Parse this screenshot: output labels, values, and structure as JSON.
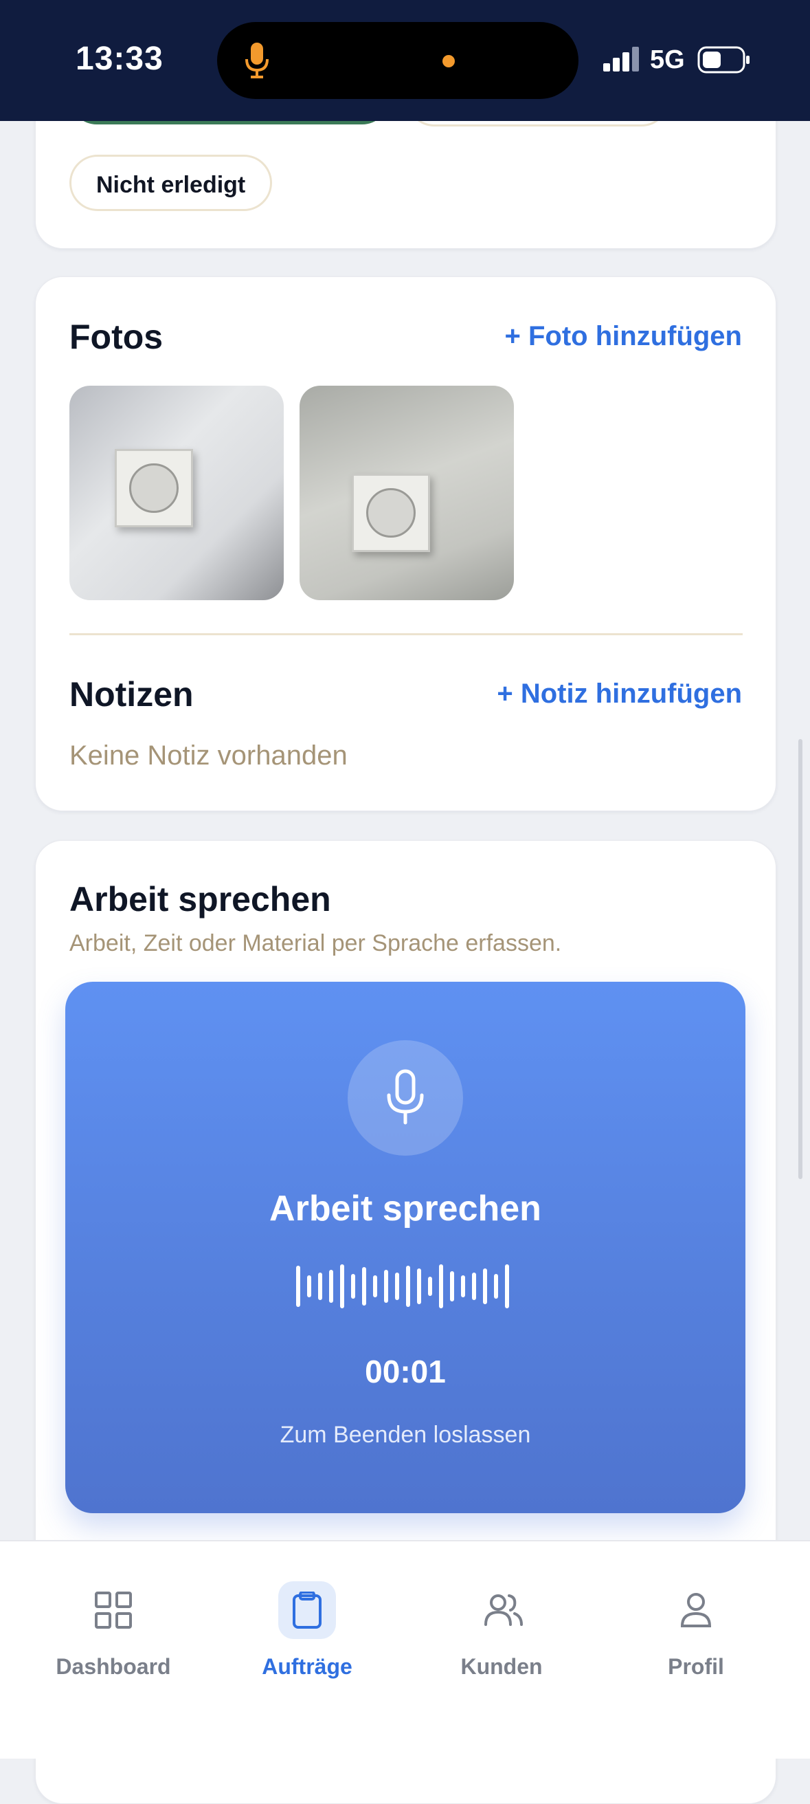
{
  "status_bar": {
    "time": "13:33",
    "network": "5G"
  },
  "status_card": {
    "not_done_label": "Nicht erledigt"
  },
  "photos": {
    "title": "Fotos",
    "add_label": "+ Foto hinzufügen"
  },
  "notes": {
    "title": "Notizen",
    "add_label": "+ Notiz hinzufügen",
    "empty_text": "Keine Notiz vorhanden"
  },
  "voice": {
    "section_title": "Arbeit sprechen",
    "subtitle": "Arbeit, Zeit oder Material per Sprache erfassen.",
    "panel_title": "Arbeit sprechen",
    "timer": "00:01",
    "hint": "Zum Beenden loslassen"
  },
  "tabs": [
    {
      "label": "Dashboard",
      "icon": "grid-icon",
      "active": false
    },
    {
      "label": "Aufträge",
      "icon": "clipboard-icon",
      "active": true
    },
    {
      "label": "Kunden",
      "icon": "users-icon",
      "active": false
    },
    {
      "label": "Profil",
      "icon": "user-icon",
      "active": false
    }
  ],
  "colors": {
    "accent": "#2f6fe0",
    "status_bar": "#101c3f",
    "done_green": "#3b7a57",
    "muted_text": "#a59477",
    "voice_panel": "#5f91f2"
  }
}
